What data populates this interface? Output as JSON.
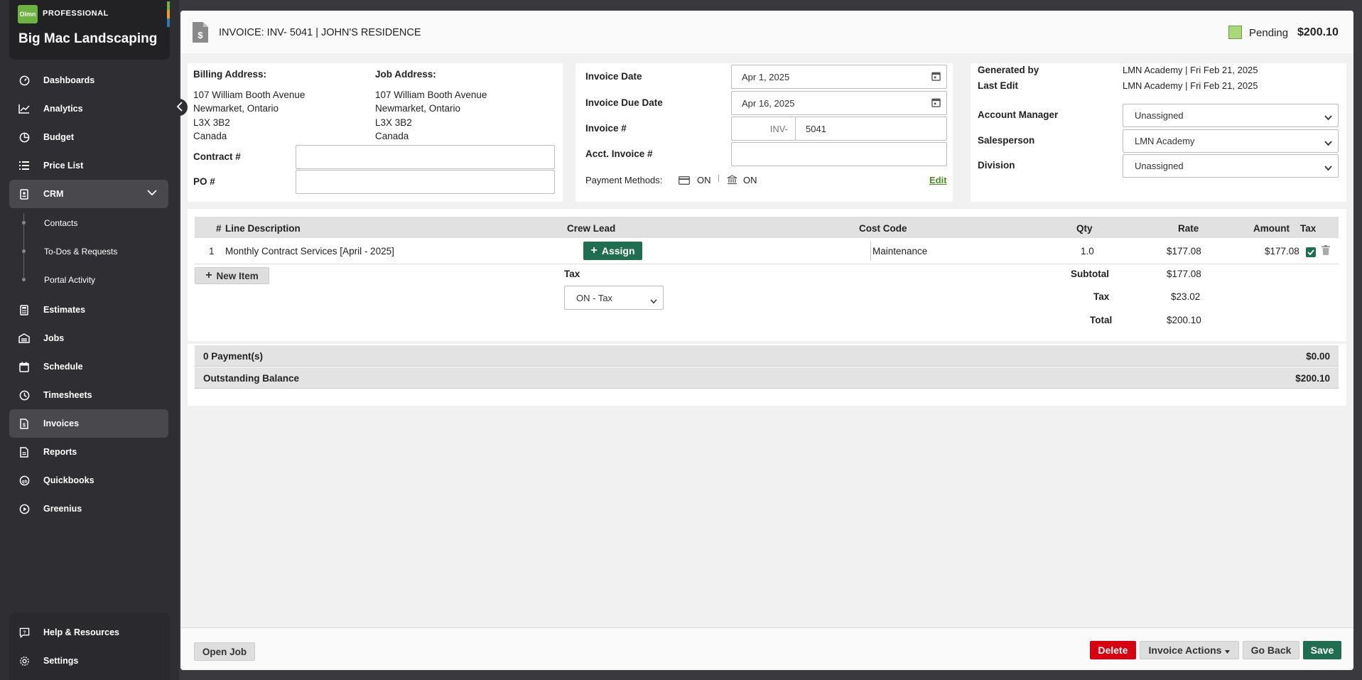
{
  "brand": {
    "logo_text": "Olmn",
    "tier": "PROFESSIONAL",
    "company": "Big Mac Landscaping"
  },
  "sidebar": {
    "items": [
      {
        "label": "Dashboards"
      },
      {
        "label": "Analytics"
      },
      {
        "label": "Budget"
      },
      {
        "label": "Price List"
      },
      {
        "label": "CRM"
      },
      {
        "label": "Estimates"
      },
      {
        "label": "Jobs"
      },
      {
        "label": "Schedule"
      },
      {
        "label": "Timesheets"
      },
      {
        "label": "Invoices"
      },
      {
        "label": "Reports"
      },
      {
        "label": "Quickbooks"
      },
      {
        "label": "Greenius"
      }
    ],
    "crm_sub": [
      {
        "label": "Contacts"
      },
      {
        "label": "To-Dos & Requests"
      },
      {
        "label": "Portal Activity"
      }
    ],
    "bottom": [
      {
        "label": "Help & Resources"
      },
      {
        "label": "Settings"
      }
    ]
  },
  "header": {
    "title": "INVOICE: INV- 5041 | JOHN'S RESIDENCE",
    "status": "Pending",
    "total": "$200.10",
    "status_color": "#a9d87a"
  },
  "addresses": {
    "billing_label": "Billing Address:",
    "job_label": "Job Address:",
    "billing": [
      "107 William Booth Avenue",
      "Newmarket, Ontario",
      "L3X 3B2",
      "Canada"
    ],
    "job": [
      "107 William Booth Avenue",
      "Newmarket, Ontario",
      "L3X 3B2",
      "Canada"
    ],
    "contract_label": "Contract #",
    "contract_value": "",
    "po_label": "PO #",
    "po_value": ""
  },
  "invoice_info": {
    "date_label": "Invoice Date",
    "date_value": "Apr 1, 2025",
    "due_label": "Invoice Due Date",
    "due_value": "Apr 16, 2025",
    "number_label": "Invoice #",
    "number_prefix": "INV-",
    "number_value": "5041",
    "acct_label": "Acct. Invoice #",
    "acct_value": "",
    "payment_label": "Payment Methods:",
    "card_state": "ON",
    "bank_state": "ON",
    "sep": "|",
    "edit_label": "Edit"
  },
  "meta": {
    "generated_label": "Generated by",
    "generated_value": "LMN Academy | Fri Feb 21, 2025",
    "last_edit_label": "Last Edit",
    "last_edit_value": "LMN Academy | Fri Feb 21, 2025",
    "account_manager_label": "Account Manager",
    "account_manager_value": "Unassigned",
    "salesperson_label": "Salesperson",
    "salesperson_value": "LMN Academy",
    "division_label": "Division",
    "division_value": "Unassigned"
  },
  "table": {
    "headers": {
      "num": "#",
      "desc": "Line Description",
      "crew": "Crew Lead",
      "cost": "Cost Code",
      "qty": "Qty",
      "rate": "Rate",
      "amount": "Amount",
      "tax": "Tax"
    },
    "rows": [
      {
        "num": "1",
        "desc": "Monthly Contract Services [April - 2025]",
        "assign": "Assign",
        "cost": "Maintenance",
        "qty": "1.0",
        "rate": "$177.08",
        "amount": "$177.08",
        "tax_checked": true
      }
    ],
    "new_item": "New Item",
    "tax_label": "Tax",
    "tax_select": "ON - Tax"
  },
  "totals": {
    "subtotal_label": "Subtotal",
    "subtotal": "$177.08",
    "tax_label": "Tax",
    "tax": "$23.02",
    "total_label": "Total",
    "total": "$200.10"
  },
  "payments": {
    "payments_label": "0 Payment(s)",
    "payments_value": "$0.00",
    "balance_label": "Outstanding Balance",
    "balance_value": "$200.10"
  },
  "footer": {
    "open_job": "Open Job",
    "delete": "Delete",
    "invoice_actions": "Invoice Actions",
    "go_back": "Go Back",
    "save": "Save"
  },
  "colors": {
    "green": "#1f6e52",
    "delete_red": "#d7000f",
    "accent_green": "#6cb33f"
  }
}
